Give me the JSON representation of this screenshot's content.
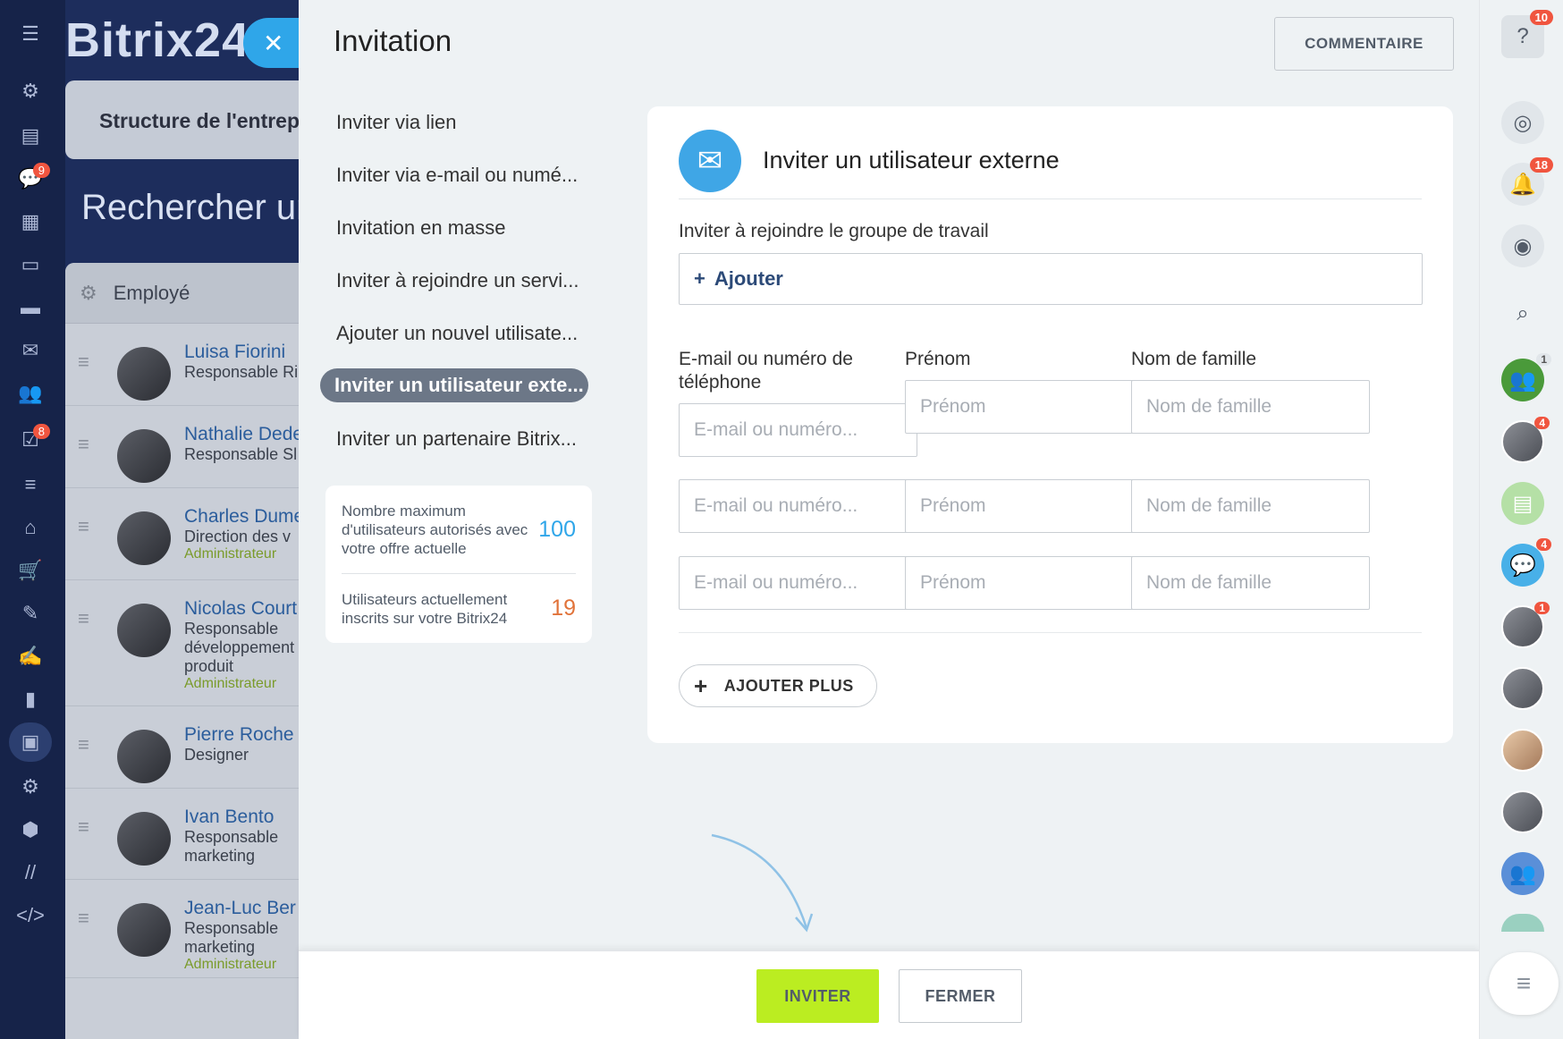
{
  "left_nav": {
    "badges": {
      "chat": "9",
      "tasks": "8"
    },
    "icons": [
      "menu-icon",
      "feed-icon",
      "news-icon",
      "chat-icon",
      "calendar-icon",
      "docs-icon",
      "drive-icon",
      "mail-icon",
      "groups-icon",
      "tasks-icon",
      "crm-icon",
      "company-icon",
      "shop-icon",
      "sign-icon",
      "esign-icon",
      "analytics-icon",
      "employees-icon",
      "automation-icon",
      "market-icon",
      "sites-icon",
      "dev-icon"
    ]
  },
  "background": {
    "logo": "Bitrix24",
    "structure_tab": "Structure de l'entrep",
    "search_title": "Rechercher un",
    "list_header": "Employé",
    "employees": [
      {
        "name": "Luisa Fiorini",
        "role": "Responsable Ri",
        "admin": ""
      },
      {
        "name": "Nathalie Dede",
        "role": "Responsable Sl",
        "admin": ""
      },
      {
        "name": "Charles Dume",
        "role": "Direction des v",
        "admin": "Administrateur"
      },
      {
        "name": "Nicolas Court",
        "role": "Responsable développement produit",
        "admin": "Administrateur"
      },
      {
        "name": "Pierre Roche",
        "role": "Designer",
        "admin": ""
      },
      {
        "name": "Ivan Bento",
        "role": "Responsable marketing",
        "admin": ""
      },
      {
        "name": "Jean-Luc Ber",
        "role": "Responsable marketing",
        "admin": "Administrateur"
      }
    ]
  },
  "panel": {
    "title": "Invitation",
    "comment_button": "COMMENTAIRE",
    "menu": [
      {
        "label": "Inviter via lien",
        "active": false
      },
      {
        "label": "Inviter via e-mail ou numé...",
        "active": false
      },
      {
        "label": "Invitation en masse",
        "active": false
      },
      {
        "label": "Inviter à rejoindre un servi...",
        "active": false
      },
      {
        "label": "Ajouter un nouvel utilisate...",
        "active": false
      },
      {
        "label": "Inviter un utilisateur exte...",
        "active": true
      },
      {
        "label": "Inviter un partenaire Bitrix...",
        "active": false
      }
    ],
    "limits": {
      "max_label": "Nombre maximum d'utilisateurs autorisés avec votre offre actuelle",
      "max_value": "100",
      "current_label": "Utilisateurs actuellement inscrits sur votre Bitrix24",
      "current_value": "19"
    },
    "card": {
      "title": "Inviter un utilisateur externe",
      "group_label": "Inviter à rejoindre le groupe de travail",
      "group_add": "Ajouter",
      "col_email": "E-mail ou numéro de téléphone",
      "col_first": "Prénom",
      "col_last": "Nom de famille",
      "placeholder_email": "E-mail ou numéro...",
      "placeholder_first": "Prénom",
      "placeholder_last": "Nom de famille",
      "add_more": "AJOUTER PLUS"
    },
    "footer": {
      "invite": "INVITER",
      "close": "FERMER"
    }
  },
  "right_bar": {
    "help_badge": "10",
    "notif_badge": "18",
    "avatar_badges": [
      "1",
      "4",
      "",
      "4",
      "1",
      "",
      "",
      "",
      ""
    ]
  }
}
